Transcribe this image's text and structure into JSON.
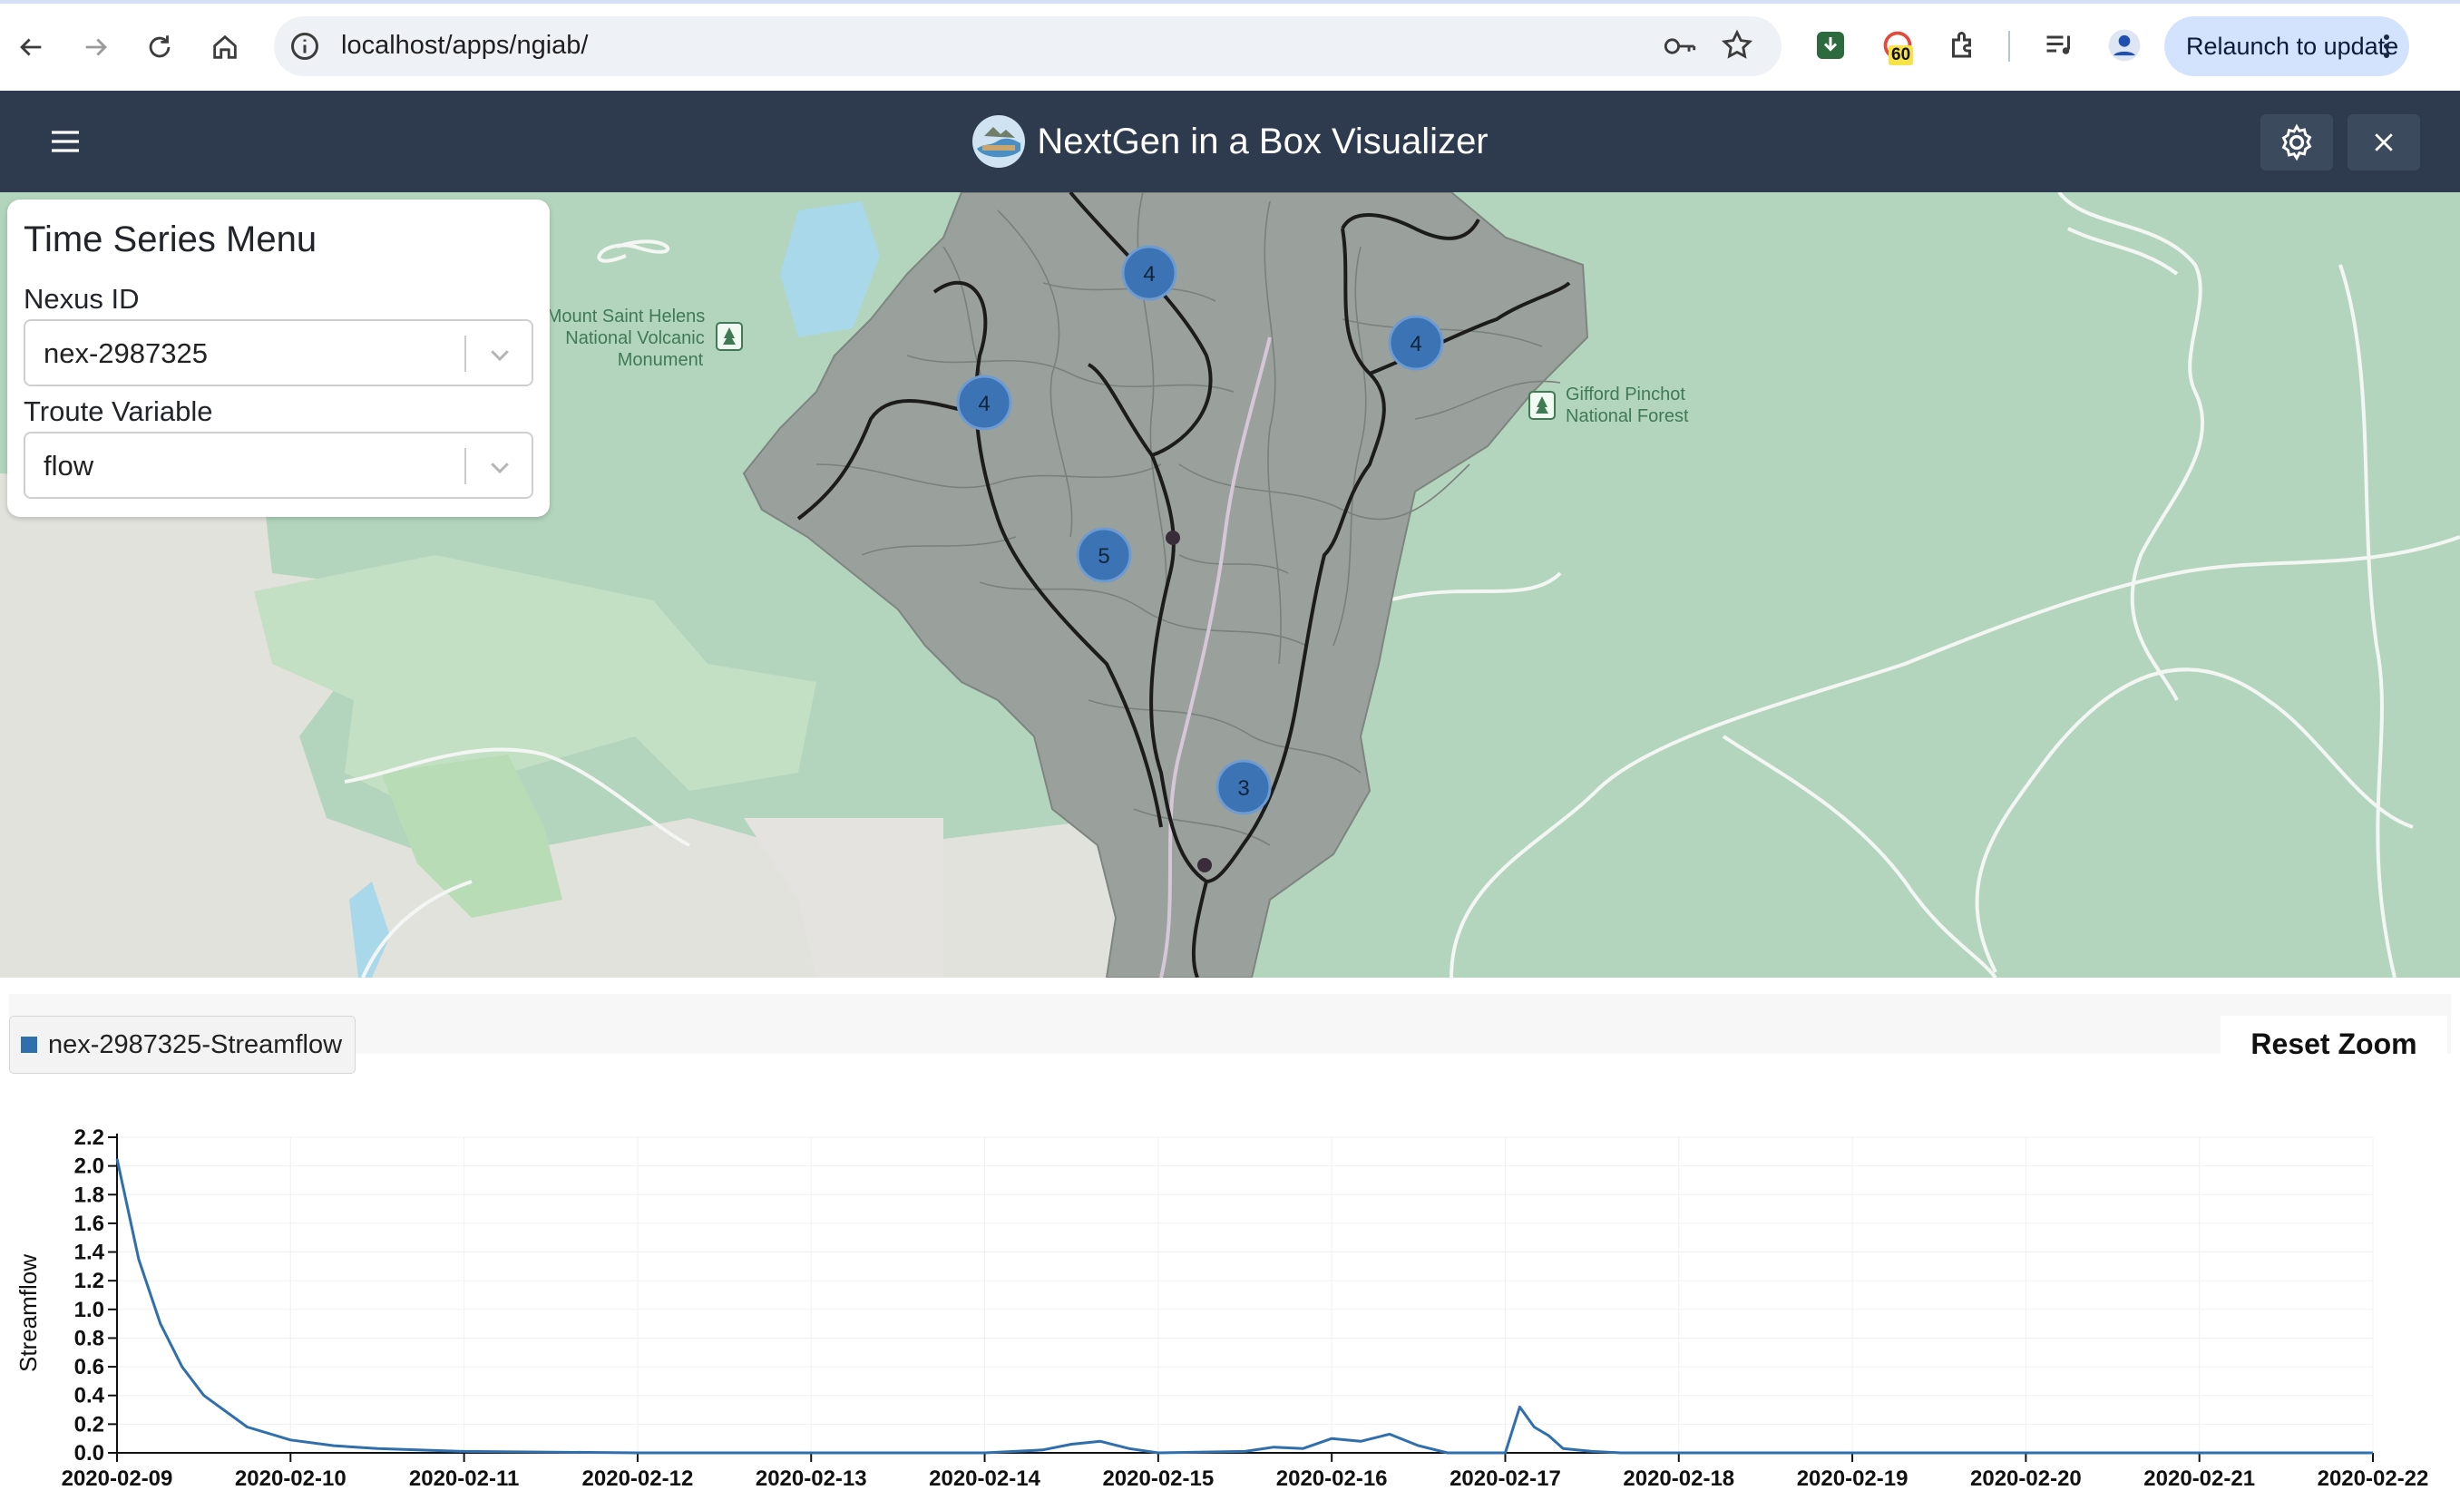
{
  "browser": {
    "url": "localhost/apps/ngiab/",
    "relaunch_label": "Relaunch to update",
    "extension_badge": "60"
  },
  "app": {
    "title": "NextGen in a Box Visualizer"
  },
  "ts_menu": {
    "heading": "Time Series Menu",
    "nexus_label": "Nexus ID",
    "nexus_value": "nex-2987325",
    "variable_label": "Troute Variable",
    "variable_value": "flow"
  },
  "map": {
    "labels": {
      "msh_line1": "Mount Saint Helens",
      "msh_line2": "National Volcanic",
      "msh_line3": "Monument",
      "gp_line1": "Gifford Pinchot",
      "gp_line2": "National Forest"
    },
    "clusters": [
      {
        "count": "4"
      },
      {
        "count": "4"
      },
      {
        "count": "4"
      },
      {
        "count": "5"
      },
      {
        "count": "3"
      }
    ],
    "colors": {
      "forest": "#b3d5bd",
      "basin": "#9aa19c",
      "cluster": "#3b73b4",
      "river": "#1c1c1c"
    }
  },
  "chart": {
    "legend_label": "nex-2987325-Streamflow",
    "reset_zoom_label": "Reset Zoom"
  },
  "chart_data": {
    "type": "line",
    "ylabel": "Streamflow",
    "xlabel": "",
    "ylim": [
      0,
      2.2
    ],
    "yticks": [
      "2.2",
      "2.0",
      "1.8",
      "1.6",
      "1.4",
      "1.2",
      "1.0",
      "0.8",
      "0.6",
      "0.4",
      "0.2",
      "0.0"
    ],
    "xticks": [
      "2020-02-09",
      "2020-02-10",
      "2020-02-11",
      "2020-02-12",
      "2020-02-13",
      "2020-02-14",
      "2020-02-15",
      "2020-02-16",
      "2020-02-17",
      "2020-02-18",
      "2020-02-19",
      "2020-02-20",
      "2020-02-21",
      "2020-02-22"
    ],
    "grid": true,
    "series": [
      {
        "name": "nex-2987325-Streamflow",
        "color": "#2f6fad",
        "x": [
          "2020-02-09 00:00",
          "2020-02-09 03:00",
          "2020-02-09 06:00",
          "2020-02-09 09:00",
          "2020-02-09 12:00",
          "2020-02-09 18:00",
          "2020-02-10 00:00",
          "2020-02-10 06:00",
          "2020-02-10 12:00",
          "2020-02-11 00:00",
          "2020-02-11 12:00",
          "2020-02-12 00:00",
          "2020-02-13 00:00",
          "2020-02-14 00:00",
          "2020-02-14 08:00",
          "2020-02-14 12:00",
          "2020-02-14 16:00",
          "2020-02-14 20:00",
          "2020-02-15 00:00",
          "2020-02-15 12:00",
          "2020-02-15 16:00",
          "2020-02-15 20:00",
          "2020-02-16 00:00",
          "2020-02-16 04:00",
          "2020-02-16 08:00",
          "2020-02-16 12:00",
          "2020-02-16 16:00",
          "2020-02-16 20:00",
          "2020-02-17 00:00",
          "2020-02-17 02:00",
          "2020-02-17 04:00",
          "2020-02-17 06:00",
          "2020-02-17 08:00",
          "2020-02-17 12:00",
          "2020-02-17 16:00",
          "2020-02-18 00:00",
          "2020-02-19 00:00",
          "2020-02-20 00:00",
          "2020-02-21 00:00",
          "2020-02-22 00:00"
        ],
        "values": [
          2.05,
          1.35,
          0.9,
          0.6,
          0.4,
          0.18,
          0.09,
          0.05,
          0.03,
          0.01,
          0.005,
          0.0,
          0.0,
          0.0,
          0.02,
          0.06,
          0.08,
          0.03,
          0.0,
          0.01,
          0.04,
          0.03,
          0.1,
          0.08,
          0.13,
          0.05,
          0.0,
          0.0,
          0.0,
          0.32,
          0.18,
          0.12,
          0.03,
          0.01,
          0.0,
          0.0,
          0.0,
          0.0,
          0.0,
          0.0
        ]
      }
    ]
  }
}
